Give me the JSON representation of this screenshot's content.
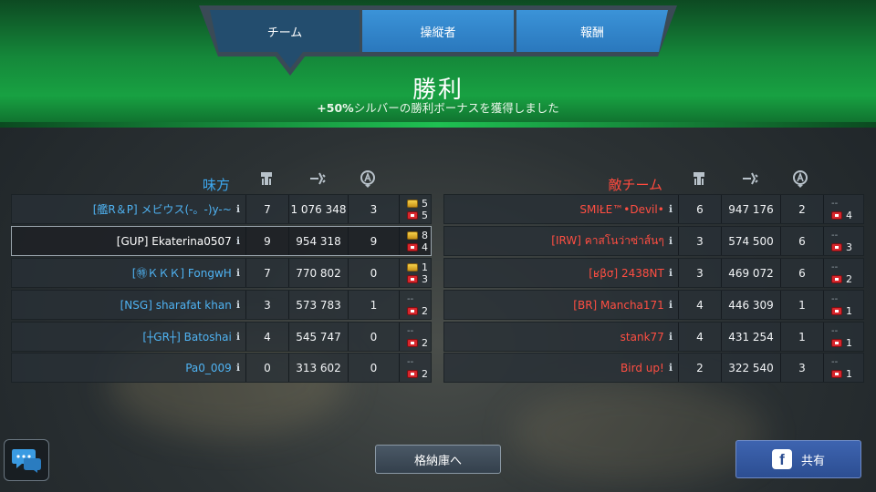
{
  "tabs": [
    {
      "label": "チーム",
      "active": true
    },
    {
      "label": "操縦者",
      "active": false
    },
    {
      "label": "報酬",
      "active": false
    }
  ],
  "result": {
    "title": "勝利",
    "bonus_bold": "+50%",
    "bonus_text": "シルバーの勝利ボーナスを獲得しました"
  },
  "ally": {
    "title": "味方",
    "rows": [
      {
        "name": "[艦R＆P] メビウス(-。-)y-~",
        "kills": "7",
        "damage": "1 076 348",
        "assists": "3",
        "gold": "5",
        "red": "5",
        "me": false
      },
      {
        "name": "[GUP] Ekaterina0507",
        "kills": "9",
        "damage": "954 318",
        "assists": "9",
        "gold": "8",
        "red": "4",
        "me": true
      },
      {
        "name": "[㊕ＫＫＫ] FongwH",
        "kills": "7",
        "damage": "770 802",
        "assists": "0",
        "gold": "1",
        "red": "3",
        "me": false
      },
      {
        "name": "[NSG] sharafat khan",
        "kills": "3",
        "damage": "573 783",
        "assists": "1",
        "gold": "--",
        "red": "2",
        "me": false
      },
      {
        "name": "[┼GR┼] Batoshai",
        "kills": "4",
        "damage": "545 747",
        "assists": "0",
        "gold": "--",
        "red": "2",
        "me": false
      },
      {
        "name": "Pa0_009",
        "kills": "0",
        "damage": "313 602",
        "assists": "0",
        "gold": "--",
        "red": "2",
        "me": false
      }
    ]
  },
  "enemy": {
    "title": "敵チーム",
    "rows": [
      {
        "name": "SMIŁE™•Devil•",
        "kills": "6",
        "damage": "947 176",
        "assists": "2",
        "gold": "--",
        "red": "4"
      },
      {
        "name": "[IRW] คาสโนว่าซ่าส์นๆ",
        "kills": "3",
        "damage": "574 500",
        "assists": "6",
        "gold": "--",
        "red": "3"
      },
      {
        "name": "[ʁβσ] 2438NT",
        "kills": "3",
        "damage": "469 072",
        "assists": "6",
        "gold": "--",
        "red": "2"
      },
      {
        "name": "[BR] Mancha171",
        "kills": "4",
        "damage": "446 309",
        "assists": "1",
        "gold": "--",
        "red": "1"
      },
      {
        "name": "stank77",
        "kills": "4",
        "damage": "431 254",
        "assists": "1",
        "gold": "--",
        "red": "1"
      },
      {
        "name": "Bird up!",
        "kills": "2",
        "damage": "322 540",
        "assists": "3",
        "gold": "--",
        "red": "1"
      }
    ]
  },
  "info_glyph": "ℹ",
  "buttons": {
    "storage": "格納庫へ",
    "share": "共有",
    "fb_letter": "f"
  },
  "icons": {
    "kills": "robot-kill-icon",
    "damage": "damage-icon",
    "assists": "assist-icon",
    "chat": "chat-bubbles-icon"
  },
  "colors": {
    "ally": "#3da8f0",
    "enemy": "#ff4a3e",
    "banner": "#18a142"
  }
}
